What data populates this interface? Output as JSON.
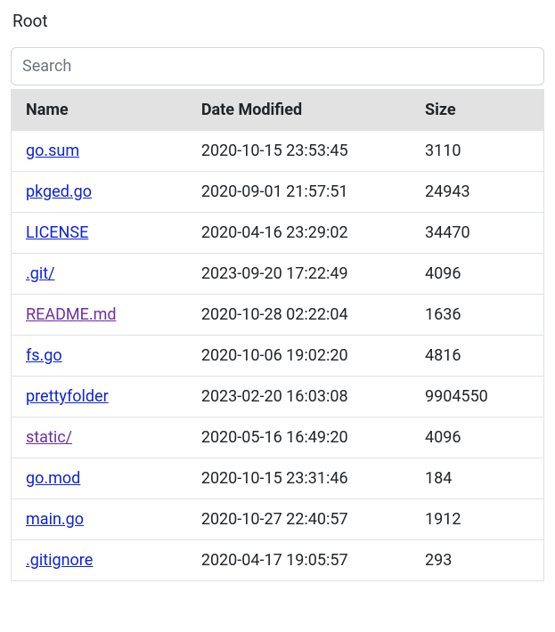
{
  "title": "Root",
  "search": {
    "placeholder": "Search",
    "value": ""
  },
  "table": {
    "headers": {
      "name": "Name",
      "date": "Date Modified",
      "size": "Size"
    },
    "rows": [
      {
        "name": "go.sum",
        "date": "2020-10-15 23:53:45",
        "size": "3110",
        "visited": false
      },
      {
        "name": "pkged.go",
        "date": "2020-09-01 21:57:51",
        "size": "24943",
        "visited": false
      },
      {
        "name": "LICENSE",
        "date": "2020-04-16 23:29:02",
        "size": "34470",
        "visited": false
      },
      {
        "name": ".git/",
        "date": "2023-09-20 17:22:49",
        "size": "4096",
        "visited": false
      },
      {
        "name": "README.md",
        "date": "2020-10-28 02:22:04",
        "size": "1636",
        "visited": true
      },
      {
        "name": "fs.go",
        "date": "2020-10-06 19:02:20",
        "size": "4816",
        "visited": false
      },
      {
        "name": "prettyfolder",
        "date": "2023-02-20 16:03:08",
        "size": "9904550",
        "visited": false
      },
      {
        "name": "static/",
        "date": "2020-05-16 16:49:20",
        "size": "4096",
        "visited": true
      },
      {
        "name": "go.mod",
        "date": "2020-10-15 23:31:46",
        "size": "184",
        "visited": false
      },
      {
        "name": "main.go",
        "date": "2020-10-27 22:40:57",
        "size": "1912",
        "visited": false
      },
      {
        "name": ".gitignore",
        "date": "2020-04-17 19:05:57",
        "size": "293",
        "visited": false
      }
    ]
  }
}
